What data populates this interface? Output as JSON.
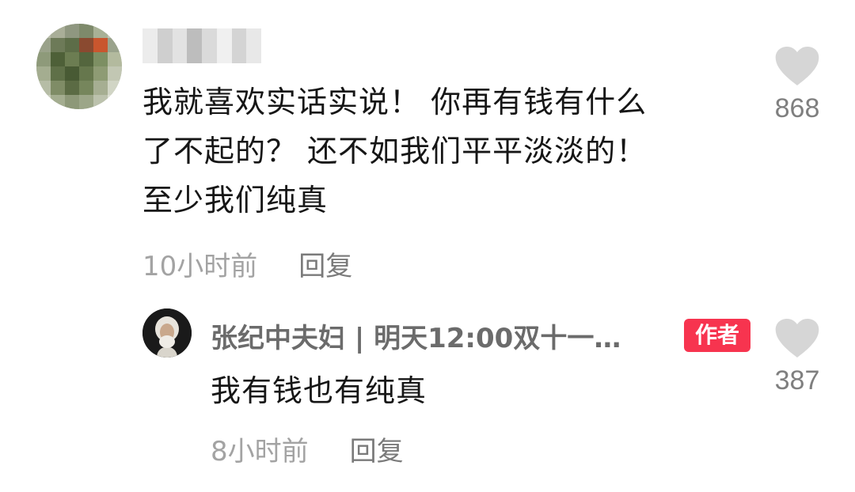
{
  "comment": {
    "username": "",
    "text_lines": [
      "我就喜欢实话实说！ 你再有钱有什么",
      "了不起的？ 还不如我们平平淡淡的！",
      "至少我们纯真"
    ],
    "time": "10小时前",
    "reply_label": "回复",
    "likes": "868"
  },
  "reply": {
    "author_name": "张纪中夫妇 | 明天12:00双十一…",
    "author_badge": "作者",
    "text": "我有钱也有纯真",
    "time": "8小时前",
    "reply_label": "回复",
    "likes": "387"
  },
  "icons": {
    "like": "heart-icon"
  },
  "colors": {
    "badge": "#f7344f",
    "heart": "#d6d6d6",
    "muted_text": "#a3a3a3"
  }
}
